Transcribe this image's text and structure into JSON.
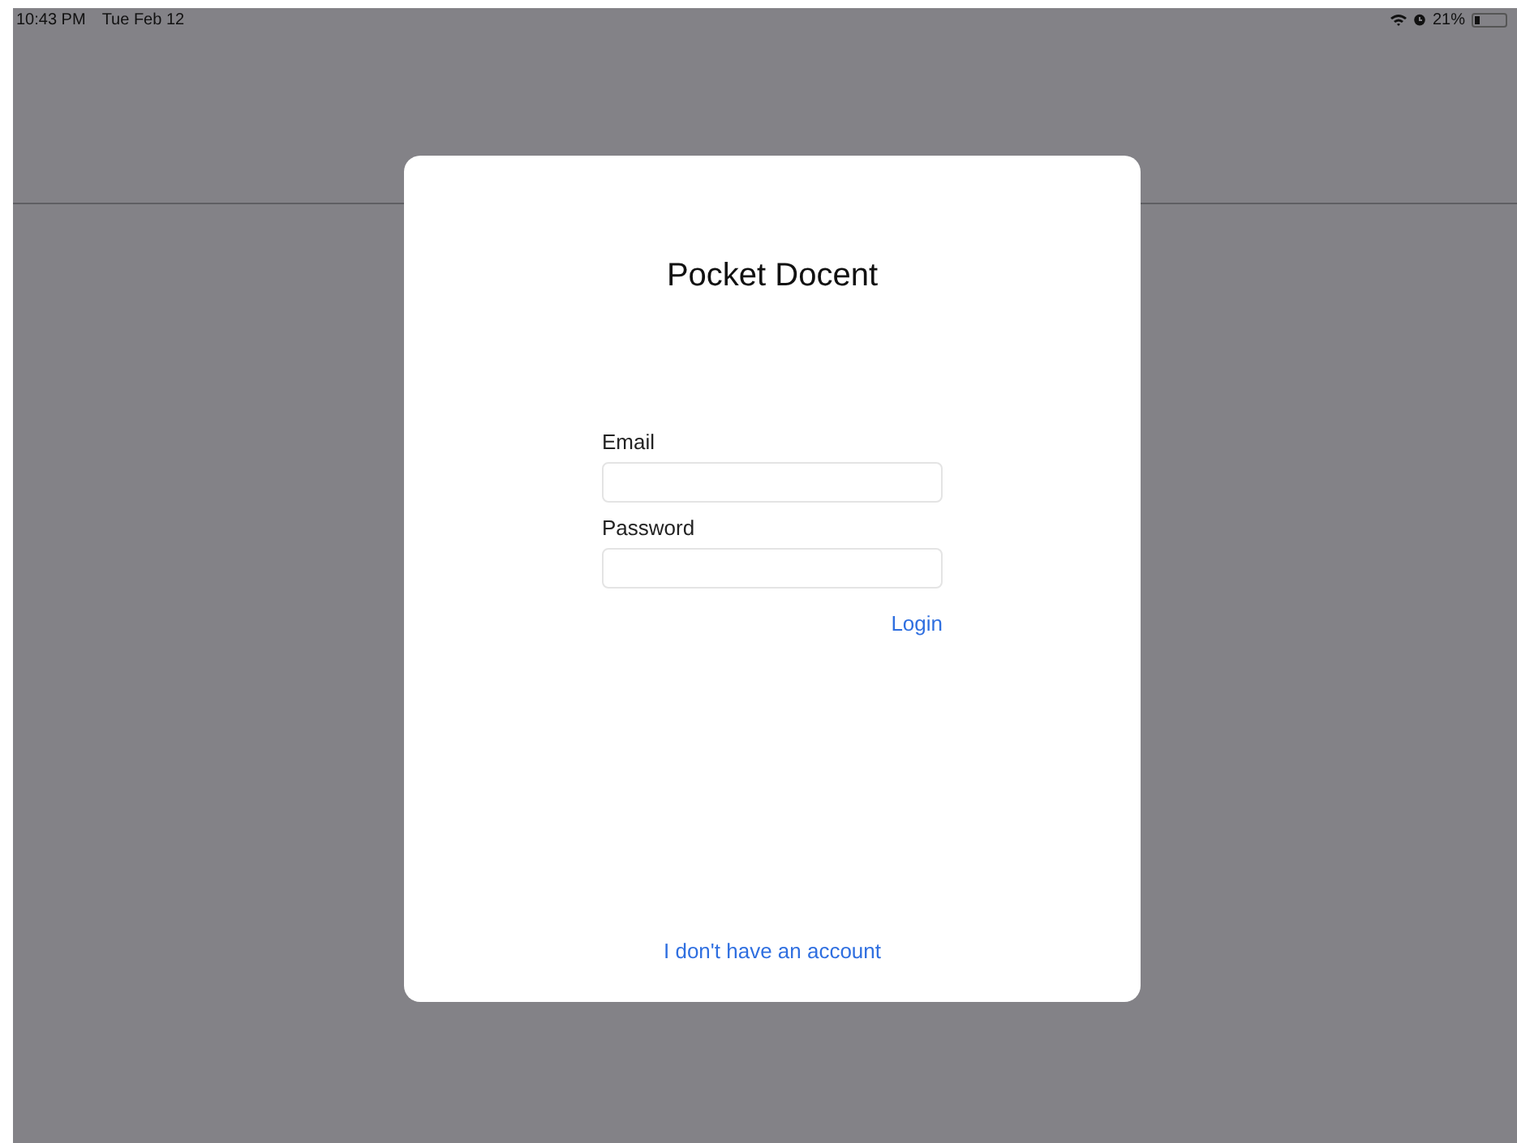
{
  "status_bar": {
    "time": "10:43 PM",
    "date": "Tue Feb 12",
    "battery_percent": "21%"
  },
  "login_dialog": {
    "title": "Pocket Docent",
    "fields": [
      {
        "label": "Email"
      },
      {
        "label": "Password"
      }
    ],
    "login_link": "Login",
    "signup_link": "I don't have an account"
  }
}
